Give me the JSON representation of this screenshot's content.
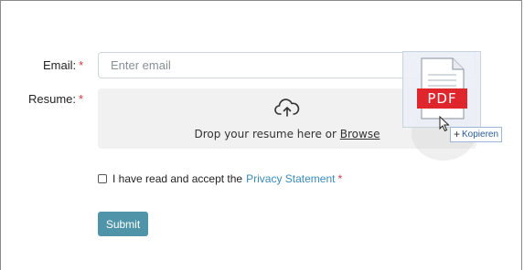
{
  "form": {
    "email_label": "Email:",
    "required_mark": "*",
    "email_placeholder": "Enter email",
    "email_value": "",
    "resume_label": "Resume:",
    "dropzone_text": "Drop your resume here or",
    "browse_label": "Browse",
    "cloud_icon": "cloud-upload-icon",
    "checkbox_text": "I have read and accept the",
    "privacy_link": "Privacy Statement",
    "checkbox_checked": false,
    "submit_label": "Submit"
  },
  "drag_overlay": {
    "file_badge": "PDF",
    "file_icon": "pdf-file-icon",
    "copy_tooltip": "Kopieren",
    "copy_symbol": "+"
  },
  "colors": {
    "accent": "#4f94a8",
    "link": "#3b8ab8",
    "required": "#d9363e",
    "pdf_red": "#e0262d"
  }
}
